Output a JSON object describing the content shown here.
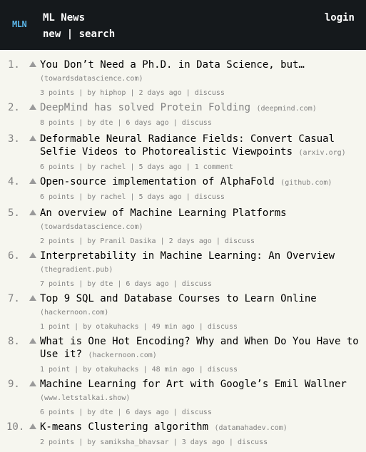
{
  "header": {
    "logo": "MLN",
    "site_title": "ML News",
    "nav": {
      "new": "new",
      "sep": " | ",
      "search": "search"
    },
    "login": "login"
  },
  "items": [
    {
      "rank": "1.",
      "title": "You Don’t Need a Ph.D. in Data Science, but…",
      "domain": "(towardsdatascience.com)",
      "points": "3 points",
      "user": "by hiphop",
      "age": "2 days ago",
      "comments": "discuss"
    },
    {
      "rank": "2.",
      "title": "DeepMind has solved Protein Folding",
      "domain": "(deepmind.com)",
      "points": "8 points",
      "user": "by dte",
      "age": "6 days ago",
      "comments": "discuss"
    },
    {
      "rank": "3.",
      "title": "Deformable Neural Radiance Fields: Convert Casual Selfie Videos to Photorealistic Viewpoints",
      "domain": "(arxiv.org)",
      "points": "6 points",
      "user": "by rachel",
      "age": "5 days ago",
      "comments": "1 comment"
    },
    {
      "rank": "4.",
      "title": "Open-source implementation of AlphaFold",
      "domain": "(github.com)",
      "points": "6 points",
      "user": "by rachel",
      "age": "5 days ago",
      "comments": "discuss"
    },
    {
      "rank": "5.",
      "title": "An overview of Machine Learning Platforms",
      "domain": "(towardsdatascience.com)",
      "points": "2 points",
      "user": "by Pranil Dasika",
      "age": "2 days ago",
      "comments": "discuss"
    },
    {
      "rank": "6.",
      "title": "Interpretability in Machine Learning: An Overview",
      "domain": "(thegradient.pub)",
      "points": "7 points",
      "user": "by dte",
      "age": "6 days ago",
      "comments": "discuss"
    },
    {
      "rank": "7.",
      "title": "Top 9 SQL and Database Courses to Learn Online",
      "domain": "(hackernoon.com)",
      "points": "1 point",
      "user": "by otakuhacks",
      "age": "49 min ago",
      "comments": "discuss"
    },
    {
      "rank": "8.",
      "title": "What is One Hot Encoding? Why and When Do You Have to Use it?",
      "domain": "(hackernoon.com)",
      "points": "1 point",
      "user": "by otakuhacks",
      "age": "48 min ago",
      "comments": "discuss"
    },
    {
      "rank": "9.",
      "title": "Machine Learning for Art with Google’s Emil Wallner",
      "domain": "(www.letstalkai.show)",
      "points": "6 points",
      "user": "by dte",
      "age": "6 days ago",
      "comments": "discuss"
    },
    {
      "rank": "10.",
      "title": "K-means Clustering algorithm",
      "domain": "(datamahadev.com)",
      "points": "2 points",
      "user": "by samiksha_bhavsar",
      "age": "3 days ago",
      "comments": "discuss"
    }
  ],
  "subtext_separator": " | ",
  "colors": {
    "header_bg": "#15191c",
    "page_bg": "#f6f6ef",
    "logo": "#5ab4e6",
    "muted": "#828282"
  }
}
